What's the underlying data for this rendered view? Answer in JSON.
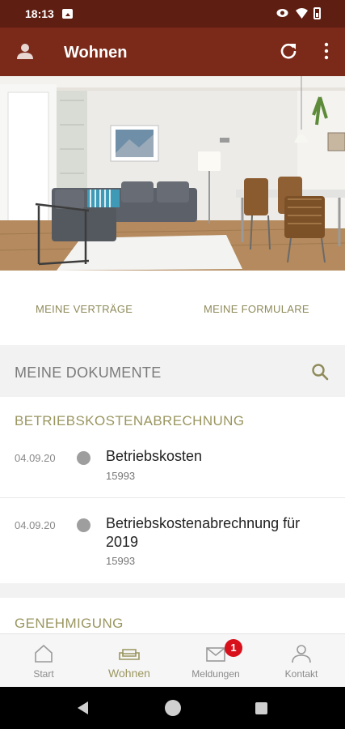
{
  "status_bar": {
    "time": "18:13"
  },
  "app_bar": {
    "title": "Wohnen"
  },
  "quick_links": {
    "left": "MEINE VERTRÄGE",
    "right": "MEINE FORMULARE"
  },
  "documents": {
    "header": "MEINE DOKUMENTE",
    "sections": [
      {
        "title": "BETRIEBSKOSTENABRECHNUNG",
        "items": [
          {
            "date": "04.09.20",
            "title": "Betriebskosten",
            "subtitle": "15993"
          },
          {
            "date": "04.09.20",
            "title": "Betriebskostenabrechnung für 2019",
            "subtitle": "15993"
          }
        ]
      },
      {
        "title": "GENEHMIGUNG",
        "items": []
      }
    ]
  },
  "bottom_nav": {
    "items": [
      {
        "label": "Start",
        "icon": "home-icon"
      },
      {
        "label": "Wohnen",
        "icon": "sofa-icon",
        "active": true
      },
      {
        "label": "Meldungen",
        "icon": "mail-icon",
        "badge": "1"
      },
      {
        "label": "Kontakt",
        "icon": "person-icon"
      }
    ]
  },
  "colors": {
    "status_bar": "#5e1e12",
    "app_bar": "#7b2a1a",
    "accent": "#9a9660",
    "badge": "#d8101b"
  }
}
